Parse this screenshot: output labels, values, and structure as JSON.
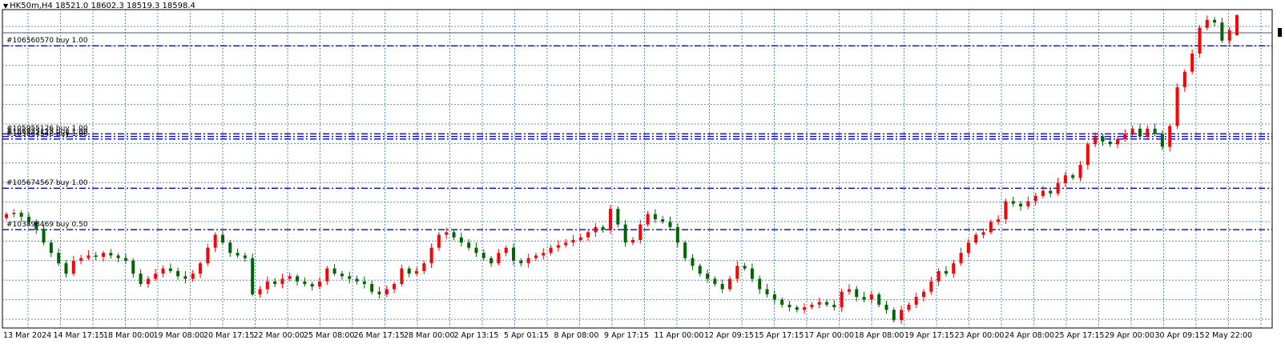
{
  "window": {
    "title": "HK50m,H4  18521.0 18602.3 18519.3 18598.4"
  },
  "orders": [
    {
      "label": "#106560570 buy 1.00",
      "price": 18480
    },
    {
      "label": "#105955126 buy 1.00",
      "price": 18140
    },
    {
      "label": "#105955125 buy 1.00",
      "price": 18130
    },
    {
      "label": "#105664548 buy 1.00",
      "price": 18120
    },
    {
      "label": "#105674567 buy 1.00",
      "price": 17930
    },
    {
      "label": "#103898469 buy 0.50",
      "price": 17770
    }
  ],
  "x_axis_labels": [
    "13 Mar 2024",
    "14 Mar 17:15",
    "18 Mar 00:00",
    "19 Mar 08:00",
    "20 Mar 17:15",
    "22 Mar 00:00",
    "25 Mar 08:00",
    "26 Mar 17:15",
    "28 Mar 00:00",
    "2 Apr 13:15",
    "5 Apr 01:15",
    "8 Apr 08:00",
    "9 Apr 17:15",
    "11 Apr 00:00",
    "12 Apr 09:15",
    "15 Apr 17:15",
    "17 Apr 00:00",
    "18 Apr 08:00",
    "19 Apr 17:15",
    "23 Apr 00:00",
    "24 Apr 08:00",
    "25 Apr 17:15",
    "29 Apr 00:00",
    "30 Apr 09:15",
    "2 May 22:00"
  ],
  "colors": {
    "bull": "#ff0000",
    "bear": "#006400",
    "grid": "#5b8bd0",
    "order_line": "#0000cc",
    "background": "#ffffff"
  },
  "chart_data": {
    "type": "candlestick",
    "symbol": "HK50m",
    "timeframe": "H4",
    "last_bar": {
      "open": 18521.0,
      "high": 18602.3,
      "low": 18519.3,
      "close": 18598.4
    },
    "y_range": [
      17390,
      18620
    ],
    "closes": [
      17830,
      17835,
      17820,
      17800,
      17770,
      17720,
      17680,
      17640,
      17600,
      17650,
      17660,
      17670,
      17665,
      17680,
      17670,
      17660,
      17650,
      17600,
      17560,
      17580,
      17600,
      17620,
      17610,
      17590,
      17580,
      17600,
      17640,
      17700,
      17750,
      17720,
      17680,
      17670,
      17660,
      17520,
      17540,
      17570,
      17560,
      17580,
      17590,
      17570,
      17560,
      17550,
      17570,
      17620,
      17600,
      17590,
      17580,
      17570,
      17560,
      17530,
      17520,
      17540,
      17560,
      17620,
      17600,
      17610,
      17640,
      17700,
      17750,
      17760,
      17740,
      17720,
      17700,
      17680,
      17660,
      17640,
      17680,
      17700,
      17650,
      17640,
      17660,
      17670,
      17680,
      17700,
      17710,
      17720,
      17730,
      17740,
      17760,
      17780,
      17770,
      17850,
      17790,
      17720,
      17730,
      17790,
      17830,
      17810,
      17800,
      17780,
      17720,
      17660,
      17630,
      17600,
      17580,
      17560,
      17540,
      17580,
      17630,
      17620,
      17580,
      17540,
      17520,
      17500,
      17480,
      17470,
      17460,
      17470,
      17480,
      17490,
      17480,
      17470,
      17530,
      17540,
      17510,
      17500,
      17520,
      17480,
      17460,
      17420,
      17460,
      17480,
      17510,
      17530,
      17570,
      17610,
      17600,
      17640,
      17680,
      17720,
      17750,
      17760,
      17800,
      17810,
      17880,
      17870,
      17860,
      17880,
      17900,
      17920,
      17910,
      17950,
      17980,
      17970,
      18020,
      18100,
      18130,
      18110,
      18100,
      18120,
      18140,
      18160,
      18130,
      18160,
      18140,
      18090,
      18170,
      18320,
      18380,
      18450,
      18550,
      18580,
      18570,
      18500,
      18540,
      18598.4
    ]
  }
}
